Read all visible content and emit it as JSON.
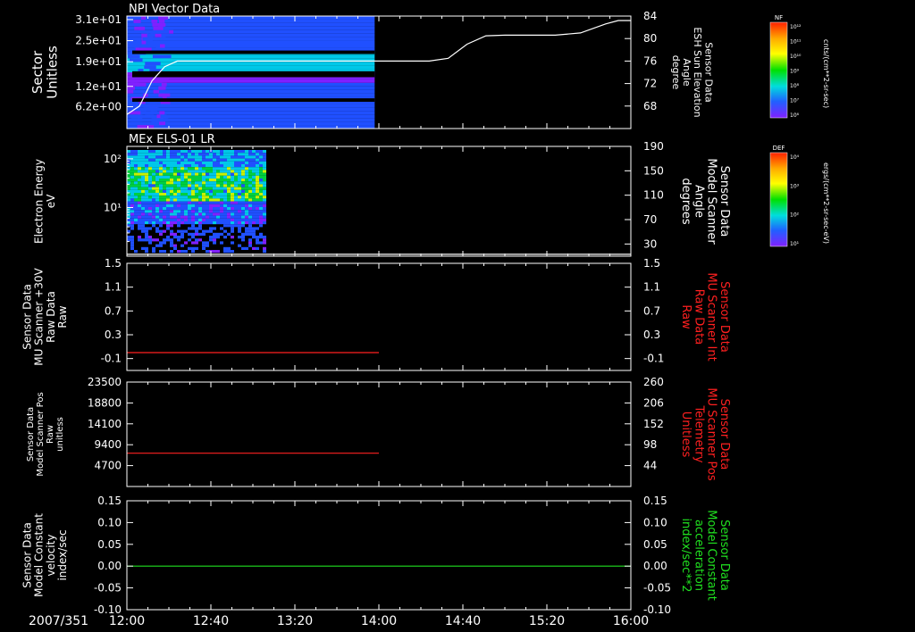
{
  "date_label": "2007/351",
  "time_ticks": [
    "12:00",
    "12:40",
    "13:20",
    "14:00",
    "14:40",
    "15:20",
    "16:00"
  ],
  "colors": {
    "background": "#000000",
    "axis": "#ffffff",
    "red": "#ff2020",
    "green": "#20e020"
  },
  "chart_data": [
    {
      "type": "heatmap",
      "title": "NPI Vector Data",
      "ylabel": "Sector\nUnitless",
      "y_ticks": [
        "3.1e+01",
        "2.5e+01",
        "1.9e+01",
        "1.2e+01",
        "6.2e+00"
      ],
      "y_tick_values": [
        31,
        25,
        19,
        12,
        6.2
      ],
      "ylim": [
        0,
        32
      ],
      "data_end_time": "13:58",
      "right_axis": {
        "label": "Sensor Data\nESH Sun Elevation\nAngle\ndegree",
        "ticks": [
          "84",
          "80",
          "76",
          "72",
          "68"
        ],
        "tick_values": [
          84,
          80,
          76,
          72,
          68
        ],
        "ylim": [
          64,
          84
        ],
        "color": "#ffffff"
      },
      "line_series": {
        "x_hours": [
          12.0,
          12.1,
          12.2,
          12.3,
          12.4,
          12.5,
          12.6,
          13.0,
          13.5,
          14.0,
          14.4,
          14.55,
          14.7,
          14.85,
          15.0,
          15.4,
          15.6,
          15.8,
          15.9,
          16.0
        ],
        "y": [
          66.5,
          68.0,
          72.5,
          75.0,
          76.0,
          76.0,
          76.0,
          76.0,
          76.0,
          76.0,
          76.0,
          76.5,
          79.0,
          80.5,
          80.6,
          80.6,
          81.0,
          82.6,
          83.2,
          83.2
        ]
      },
      "colorbar": {
        "label": "NF",
        "units": "cnts/(cm**2-sr-sec)",
        "ticks": [
          "10¹²",
          "10¹¹",
          "10¹⁰",
          "10⁹",
          "10⁸",
          "10⁷",
          "10⁶"
        ],
        "color_stops": [
          "#ff2000",
          "#ffaa00",
          "#ffff00",
          "#00e000",
          "#00dddd",
          "#2060ff",
          "#8020ff"
        ]
      }
    },
    {
      "type": "heatmap",
      "title": "MEx ELS-01 LR",
      "ylabel": "Electron Energy\neV",
      "y_ticks": [
        "10²",
        "10¹"
      ],
      "y_tick_values": [
        100,
        10
      ],
      "ylim": [
        1,
        180
      ],
      "y_scale": "log",
      "data_end_time": "13:06",
      "right_axis": {
        "label": "Sensor Data\nModel Scanner\nAngle\ndegrees",
        "ticks": [
          "190",
          "150",
          "110",
          "70",
          "30"
        ],
        "tick_values": [
          190,
          150,
          110,
          70,
          30
        ],
        "ylim": [
          10,
          190
        ],
        "color": "#ffffff"
      },
      "line_series": {
        "x_hours": [
          12.0,
          16.0
        ],
        "y": [
          13,
          13
        ]
      },
      "colorbar": {
        "label": "DEF",
        "units": "ergs/(cm**2-sr-sec-eV)",
        "ticks": [
          "10⁴",
          "10³",
          "10²",
          "10¹"
        ],
        "color_stops": [
          "#ff2000",
          "#ffaa00",
          "#ffff00",
          "#00e000",
          "#00dddd",
          "#2060ff",
          "#8020ff"
        ]
      }
    },
    {
      "type": "line",
      "ylabel": "Sensor Data\nMU Scanner +30V\nRaw Data\nRaw",
      "y_ticks": [
        "1.5",
        "1.1",
        "0.7",
        "0.3",
        "-0.1"
      ],
      "y_tick_values": [
        1.5,
        1.1,
        0.7,
        0.3,
        -0.1
      ],
      "ylim": [
        -0.3,
        1.5
      ],
      "right_axis": {
        "label": "Sensor Data\nMU Scanner Int\nRaw Data\nRaw",
        "ticks": [
          "1.5",
          "1.1",
          "0.7",
          "0.3",
          "-0.1"
        ],
        "tick_values": [
          1.5,
          1.1,
          0.7,
          0.3,
          -0.1
        ],
        "ylim": [
          -0.3,
          1.5
        ],
        "color": "#ff2020"
      },
      "series": [
        {
          "x_hours": [
            12.0,
            14.0
          ],
          "y": [
            0.0,
            0.0
          ],
          "color": "#ff2020"
        }
      ]
    },
    {
      "type": "line",
      "ylabel": "Sensor Data\nModel Scanner Pos\nRaw\nunitless",
      "y_ticks": [
        "23500",
        "18800",
        "14100",
        "9400",
        "4700"
      ],
      "y_tick_values": [
        23500,
        18800,
        14100,
        9400,
        4700
      ],
      "ylim": [
        0,
        23500
      ],
      "right_axis": {
        "label": "Sensor Data\nMU Scanner Pos\nTelemetry\nUnitless",
        "ticks": [
          "260",
          "206",
          "152",
          "98",
          "44"
        ],
        "tick_values": [
          260,
          206,
          152,
          98,
          44
        ],
        "ylim": [
          -10,
          260
        ],
        "color": "#ff2020"
      },
      "series": [
        {
          "x_hours": [
            12.0,
            14.0
          ],
          "y": [
            7500,
            7500
          ],
          "color": "#ff2020"
        }
      ]
    },
    {
      "type": "line",
      "ylabel": "Sensor Data\nModel Constant\nvelocity\nindex/sec",
      "y_ticks": [
        "0.15",
        "0.10",
        "0.05",
        "0.00",
        "-0.05",
        "-0.10"
      ],
      "y_tick_values": [
        0.15,
        0.1,
        0.05,
        0.0,
        -0.05,
        -0.1
      ],
      "ylim": [
        -0.1,
        0.15
      ],
      "right_axis": {
        "label": "Sensor Data\nModel Constant\nacceleration\nindex/sec**2",
        "ticks": [
          "0.15",
          "0.10",
          "0.05",
          "0.00",
          "-0.05",
          "-0.10"
        ],
        "tick_values": [
          0.15,
          0.1,
          0.05,
          0.0,
          -0.05,
          -0.1
        ],
        "ylim": [
          -0.1,
          0.15
        ],
        "color": "#20e020"
      },
      "series": [
        {
          "x_hours": [
            12.0,
            16.0
          ],
          "y": [
            0.0,
            0.0
          ],
          "color": "#20e020"
        }
      ]
    }
  ]
}
